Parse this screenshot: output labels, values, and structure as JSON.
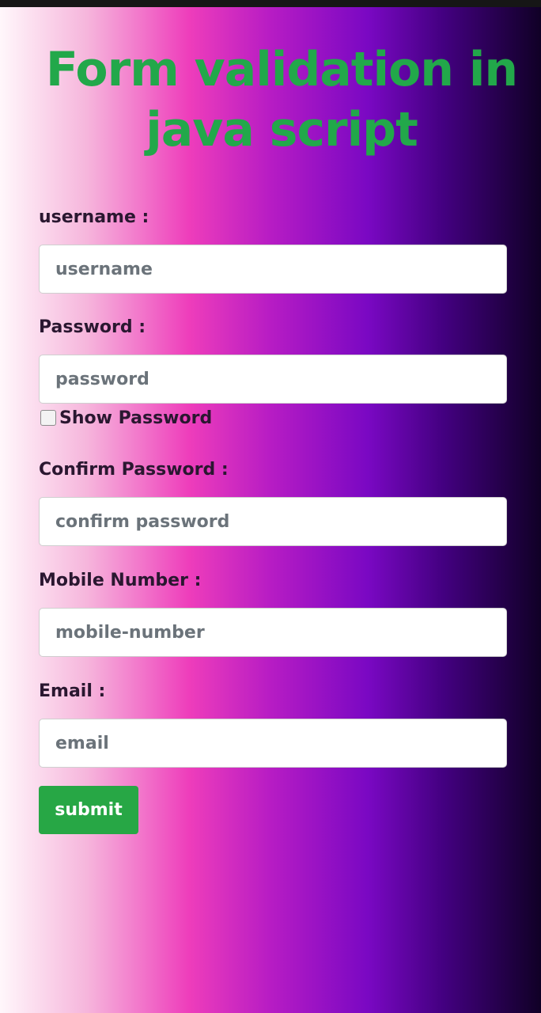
{
  "page": {
    "title": "Form validation in java script"
  },
  "form": {
    "username": {
      "label": "username :",
      "placeholder": "username"
    },
    "password": {
      "label": "Password :",
      "placeholder": "password"
    },
    "show_password": {
      "label": "Show Password",
      "checked": false
    },
    "confirm_password": {
      "label": "Confirm Password :",
      "placeholder": "confirm password"
    },
    "mobile": {
      "label": "Mobile Number :",
      "placeholder": "mobile-number"
    },
    "email": {
      "label": "Email :",
      "placeholder": "email"
    },
    "submit_label": "submit"
  },
  "colors": {
    "title": "#22a84a",
    "submit_bg": "#27a745",
    "label_text": "#2a1730",
    "gradient": [
      "#fff7fb",
      "#ee3dbb",
      "#7a08c3",
      "#100026"
    ]
  }
}
